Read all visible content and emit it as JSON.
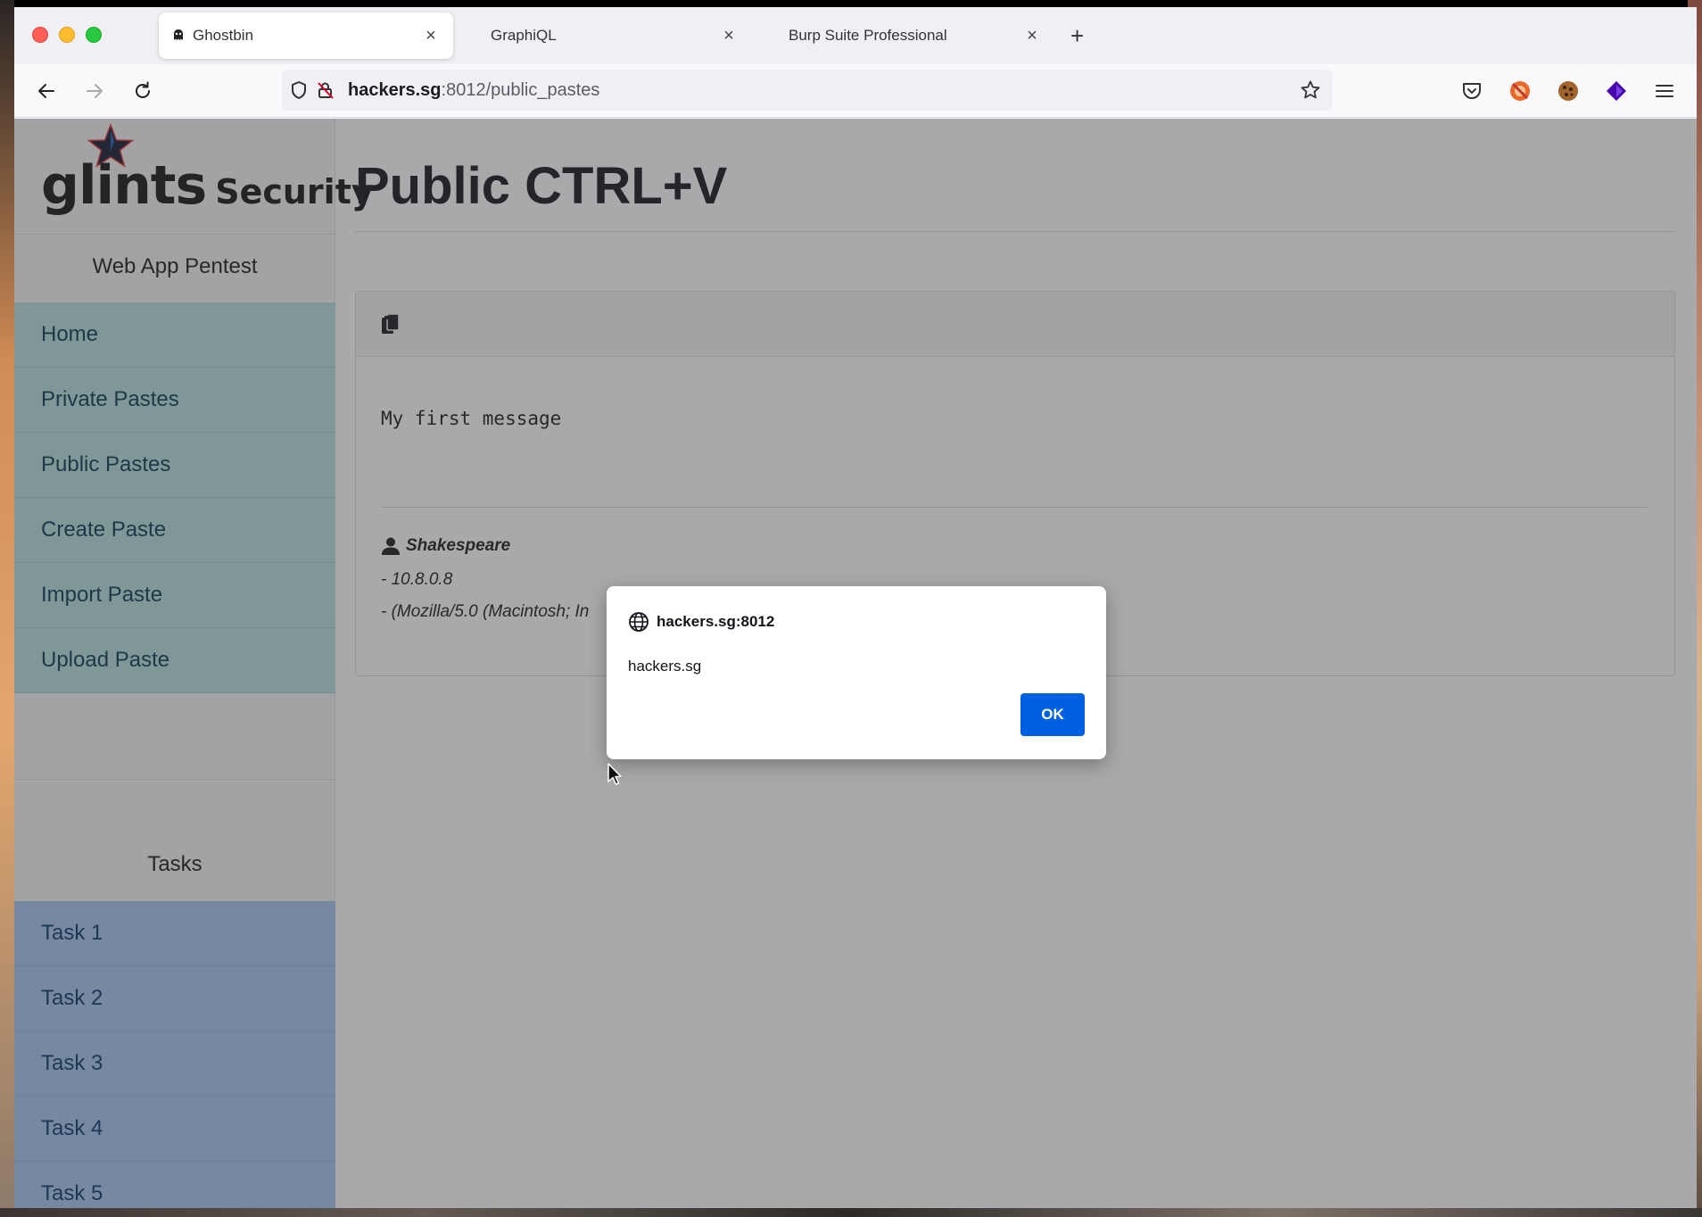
{
  "browser": {
    "tabs": [
      {
        "title": "Ghostbin",
        "active": true
      },
      {
        "title": "GraphiQL",
        "active": false
      },
      {
        "title": "Burp Suite Professional",
        "active": false
      }
    ],
    "url": {
      "host": "hackers.sg",
      "path": ":8012/public_pastes"
    }
  },
  "sidebar": {
    "logo": {
      "brand": "glints",
      "suffix": "Security"
    },
    "app_section_title": "Web App Pentest",
    "app_items": [
      {
        "label": "Home"
      },
      {
        "label": "Private Pastes"
      },
      {
        "label": "Public Pastes"
      },
      {
        "label": "Create Paste"
      },
      {
        "label": "Import Paste"
      },
      {
        "label": "Upload Paste"
      }
    ],
    "tasks_section_title": "Tasks",
    "task_items": [
      {
        "label": "Task 1"
      },
      {
        "label": "Task 2"
      },
      {
        "label": "Task 3"
      },
      {
        "label": "Task 4"
      },
      {
        "label": "Task 5"
      }
    ]
  },
  "main": {
    "page_title": "Public CTRL+V",
    "paste": {
      "content": "My first message",
      "author": "Shakespeare",
      "ip": "- 10.8.0.8",
      "user_agent": "- (Mozilla/5.0 (Macintosh; In"
    }
  },
  "dialog": {
    "origin": "hackers.sg:8012",
    "message": "hackers.sg",
    "ok_label": "OK"
  },
  "colors": {
    "app_menu_bg": "#b8e0de",
    "task_menu_bg": "#aac9ee",
    "ok_button": "#0061e0"
  }
}
